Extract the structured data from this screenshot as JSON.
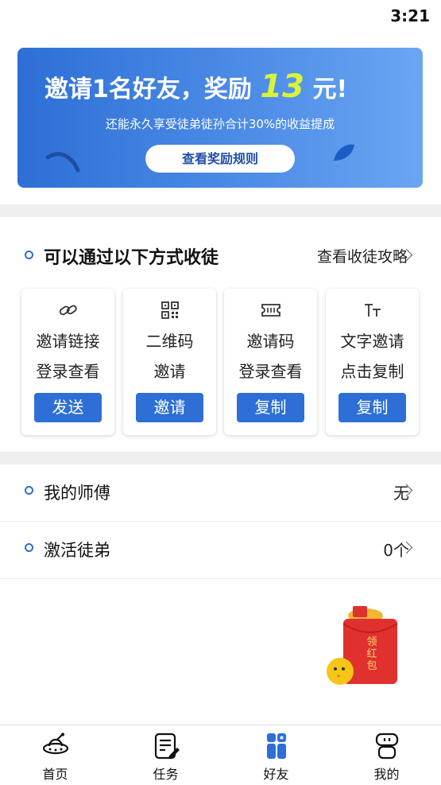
{
  "status": {
    "time": "3:21"
  },
  "banner": {
    "title_prefix": "邀请1名好友，奖励",
    "amount": "13",
    "title_suffix": "元!",
    "subtitle": "还能永久享受徒弟徒孙合计30%的收益提成",
    "button_label": "查看奖励规则"
  },
  "methods": {
    "title": "可以通过以下方式收徒",
    "link_label": "查看收徒攻略",
    "cards": [
      {
        "icon": "link-icon",
        "line1": "邀请链接",
        "line2": "登录查看",
        "button": "发送"
      },
      {
        "icon": "qr-code-icon",
        "line1": "二维码",
        "line2": "邀请",
        "button": "邀请"
      },
      {
        "icon": "ticket-code-icon",
        "line1": "邀请码",
        "line2": "登录查看",
        "button": "复制"
      },
      {
        "icon": "text-size-icon",
        "line1": "文字邀请",
        "line2": "点击复制",
        "button": "复制"
      }
    ]
  },
  "rows": {
    "master": {
      "label": "我的师傅",
      "value": "无"
    },
    "activate": {
      "label": "激活徒弟",
      "value": "0个"
    }
  },
  "red_packet": {
    "label": "领红包"
  },
  "tabbar": {
    "items": [
      {
        "label": "首页",
        "icon": "home-ufo-icon"
      },
      {
        "label": "任务",
        "icon": "task-icon"
      },
      {
        "label": "好友",
        "icon": "friends-icon"
      },
      {
        "label": "我的",
        "icon": "profile-robot-icon"
      }
    ]
  },
  "colors": {
    "accent": "#2d6fd6",
    "amount": "#d7f43a",
    "red_packet": "#e0312f"
  }
}
